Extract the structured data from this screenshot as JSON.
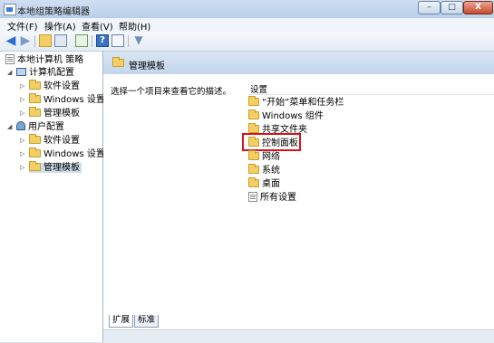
{
  "window": {
    "title": "本地组策略编辑器",
    "min_label": "–",
    "max_label": "□",
    "close_label": "X"
  },
  "menu": [
    "文件(F)",
    "操作(A)",
    "查看(V)",
    "帮助(H)"
  ],
  "tree": {
    "root": "本地计算机 策略",
    "computer_config": "计算机配置",
    "software_settings": "软件设置",
    "windows_settings": "Windows 设置",
    "admin_templates": "管理模板",
    "user_config": "用户配置",
    "user_software_settings": "软件设置",
    "user_windows_settings": "Windows 设置",
    "user_admin_templates": "管理模板"
  },
  "header": {
    "title": "管理模板"
  },
  "description": "选择一个项目来查看它的描述。",
  "settings_header": "设置",
  "items": [
    "“开始”菜单和任务栏",
    "Windows 组件",
    "共享文件夹",
    "控制面板",
    "网络",
    "系统",
    "桌面",
    "所有设置"
  ],
  "tabs": {
    "extended": "扩展",
    "standard": "标准"
  },
  "colors": {
    "highlight_border": "#d9121a",
    "header_band": "#c4d6ec",
    "folder": "#f3cf63"
  }
}
